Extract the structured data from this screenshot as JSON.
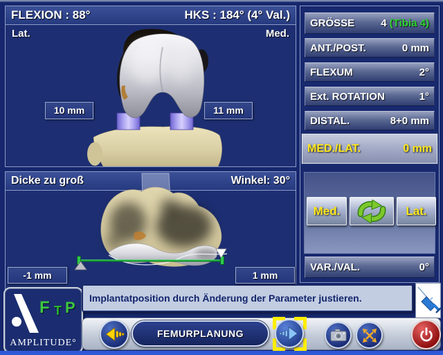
{
  "colors": {
    "accent_green": "#2ed22e",
    "highlight_yellow": "#ffe81c",
    "power_red": "#b01010",
    "panel_navy": "#1d2f72"
  },
  "top_view": {
    "flexion": "FLEXION : 88°",
    "hks": "HKS : 184° (4° Val.)",
    "lat": "Lat.",
    "med": "Med.",
    "left_gap": "10 mm",
    "right_gap": "11 mm"
  },
  "bottom_view": {
    "title": "Dicke zu groß",
    "angle": "Winkel: 30°",
    "left_offset": "-1 mm",
    "right_offset": "1 mm"
  },
  "params": {
    "rows": [
      {
        "label": "GRÖSSE",
        "value": "4",
        "value2": "(Tibia 4)"
      },
      {
        "label": "ANT./POST.",
        "value": "0 mm"
      },
      {
        "label": "FLEXUM",
        "value": "2°"
      },
      {
        "label": "Ext. ROTATION",
        "value": "1°"
      },
      {
        "label": "DISTAL.",
        "value": "8+0 mm"
      },
      {
        "label": "MED./LAT.",
        "value": "0 mm"
      }
    ],
    "med_button": "Med.",
    "lat_button": "Lat.",
    "var_val_label": "VAR./VAL.",
    "var_val_value": "0°"
  },
  "footer": {
    "message": "Implantatposition durch Änderung der Parameter justieren.",
    "nav_label": "FEMURPLANUNG",
    "brand": "AMPLITUDE°",
    "logo_letters": [
      "F",
      "T",
      "P"
    ]
  },
  "icons": {
    "back": "back-arrow-icon",
    "forward": "forward-arrow-icon",
    "camera": "camera-icon",
    "expand": "expand-icon",
    "power": "power-icon",
    "swap": "swap-arrows-icon",
    "tool": "pointer-tool-icon"
  }
}
